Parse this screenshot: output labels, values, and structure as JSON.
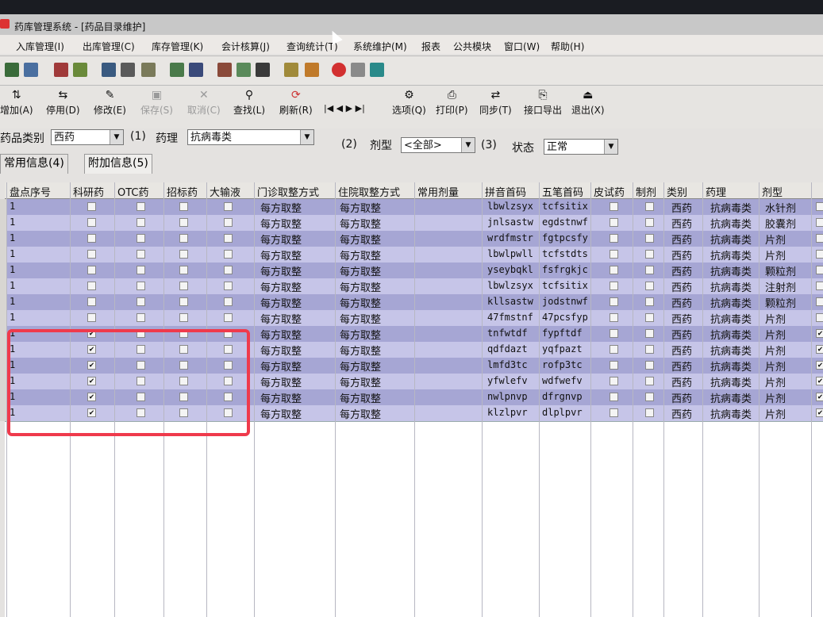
{
  "window": {
    "title": "药库管理系统 - [药品目录维护]"
  },
  "menu": [
    "入库管理(I)",
    "出库管理(C)",
    "库存管理(K)",
    "会计核算(J)",
    "查询统计(T)",
    "系统维护(M)",
    "报表",
    "公共模块",
    "窗口(W)",
    "帮助(H)"
  ],
  "toolbar": [
    {
      "label": "增加(A)",
      "icon": "add-icon",
      "enabled": true
    },
    {
      "label": "停用(D)",
      "icon": "disable-icon",
      "enabled": true
    },
    {
      "label": "修改(E)",
      "icon": "edit-icon",
      "enabled": true
    },
    {
      "label": "保存(S)",
      "icon": "save-icon",
      "enabled": false
    },
    {
      "label": "取消(C)",
      "icon": "cancel-icon",
      "enabled": false
    },
    {
      "label": "查找(L)",
      "icon": "search-icon",
      "enabled": true
    },
    {
      "label": "刷新(R)",
      "icon": "refresh-icon",
      "enabled": true
    },
    {
      "label": "选项(Q)",
      "icon": "options-icon",
      "enabled": true
    },
    {
      "label": "打印(P)",
      "icon": "print-icon",
      "enabled": true
    },
    {
      "label": "同步(T)",
      "icon": "sync-icon",
      "enabled": true
    },
    {
      "label": "接口导出",
      "icon": "export-icon",
      "enabled": true
    },
    {
      "label": "退出(X)",
      "icon": "exit-icon",
      "enabled": true
    }
  ],
  "nav_arrows": [
    "|◀",
    "◀",
    "▶",
    "▶|"
  ],
  "filter": {
    "category_label": "药品类别",
    "category_value": "西药",
    "index1": "(1)",
    "pharm_label": "药理",
    "pharm_value": "抗病毒类",
    "index2": "(2)",
    "dosage_label": "剂型",
    "dosage_value": "<全部>",
    "index3": "(3)",
    "status_label": "状态",
    "status_value": "正常"
  },
  "tabs": [
    "常用信息(4)",
    "附加信息(5)"
  ],
  "columns": [
    "盘点序号",
    "科研药",
    "OTC药",
    "招标药",
    "大输液",
    "门诊取整方式",
    "住院取整方式",
    "常用剂量",
    "拼音首码",
    "五笔首码",
    "皮试药",
    "制剂",
    "类别",
    "药理",
    "剂型"
  ],
  "rows": [
    {
      "seq": "1",
      "keyan": false,
      "py": "lbwlzsyx",
      "wb": "tcfsitix",
      "cat": "西药",
      "pharm": "抗病毒类",
      "form": "水针剂",
      "last": false
    },
    {
      "seq": "1",
      "keyan": false,
      "py": "jnlsastw",
      "wb": "egdstnwf",
      "cat": "西药",
      "pharm": "抗病毒类",
      "form": "胶囊剂",
      "last": false
    },
    {
      "seq": "1",
      "keyan": false,
      "py": "wrdfmstr",
      "wb": "fgtpcsfy",
      "cat": "西药",
      "pharm": "抗病毒类",
      "form": "片剂",
      "last": false
    },
    {
      "seq": "1",
      "keyan": false,
      "py": "lbwlpwll",
      "wb": "tcfstdts",
      "cat": "西药",
      "pharm": "抗病毒类",
      "form": "片剂",
      "last": false
    },
    {
      "seq": "1",
      "keyan": false,
      "py": "yseybqkl",
      "wb": "fsfrgkjc",
      "cat": "西药",
      "pharm": "抗病毒类",
      "form": "颗粒剂",
      "last": false
    },
    {
      "seq": "1",
      "keyan": false,
      "py": "lbwlzsyx",
      "wb": "tcfsitix",
      "cat": "西药",
      "pharm": "抗病毒类",
      "form": "注射剂",
      "last": false
    },
    {
      "seq": "1",
      "keyan": false,
      "py": "kllsastw",
      "wb": "jodstnwf",
      "cat": "西药",
      "pharm": "抗病毒类",
      "form": "颗粒剂",
      "last": false
    },
    {
      "seq": "1",
      "keyan": false,
      "py": "47fmstnf",
      "wb": "47pcsfyp",
      "cat": "西药",
      "pharm": "抗病毒类",
      "form": "片剂",
      "last": false
    },
    {
      "seq": "1",
      "keyan": true,
      "py": "tnfwtdf",
      "wb": "fypftdf",
      "cat": "西药",
      "pharm": "抗病毒类",
      "form": "片剂",
      "last": true
    },
    {
      "seq": "1",
      "keyan": true,
      "py": "qdfdazt",
      "wb": "yqfpazt",
      "cat": "西药",
      "pharm": "抗病毒类",
      "form": "片剂",
      "last": true
    },
    {
      "seq": "1",
      "keyan": true,
      "py": "lmfd3tc",
      "wb": "rofp3tc",
      "cat": "西药",
      "pharm": "抗病毒类",
      "form": "片剂",
      "last": true
    },
    {
      "seq": "1",
      "keyan": true,
      "py": "yfwlefv",
      "wb": "wdfwefv",
      "cat": "西药",
      "pharm": "抗病毒类",
      "form": "片剂",
      "last": true
    },
    {
      "seq": "1",
      "keyan": true,
      "py": "nwlpnvp",
      "wb": "dfrgnvp",
      "cat": "西药",
      "pharm": "抗病毒类",
      "form": "片剂",
      "last": true
    },
    {
      "seq": "1",
      "keyan": true,
      "py": "klzlpvr",
      "wb": "dlplpvr",
      "cat": "西药",
      "pharm": "抗病毒类",
      "form": "片剂",
      "last": true
    }
  ],
  "rounding": {
    "outpatient": "每方取整",
    "inpatient": "每方取整"
  },
  "colors": {
    "row_dark": "#a6a6d4",
    "row_light": "#c6c5e8",
    "highlight": "#ef3a4c"
  }
}
